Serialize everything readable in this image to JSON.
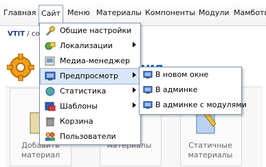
{
  "menubar": {
    "items": [
      "Главная",
      "Сайт",
      "Меню",
      "Материалы",
      "Компоненты",
      "Модули",
      "Мамботы"
    ],
    "active": "Сайт"
  },
  "breadcrumb": {
    "strong": "VTIT",
    "rest": " / co"
  },
  "page": {
    "heading_fragment": "ция",
    "tiles": [
      {
        "label_line1": "Добавить",
        "label_line2": "материал"
      },
      {
        "label_line1": "",
        "label_line2": "материалы"
      },
      {
        "label_line1": "Статичные",
        "label_line2": "материалы"
      }
    ]
  },
  "dropdown": {
    "items": [
      {
        "label": "Общие настройки",
        "icon": "wrench-settings-icon",
        "submenu": false
      },
      {
        "label": "Локализации",
        "icon": "localization-icon",
        "submenu": true
      },
      {
        "label": "Медиа-менеджер",
        "icon": "media-manager-icon",
        "submenu": false
      },
      {
        "label": "Предпросмотр",
        "icon": "preview-monitor-icon",
        "submenu": true,
        "highlighted": true
      },
      {
        "label": "Статистика",
        "icon": "globe-statistics-icon",
        "submenu": true
      },
      {
        "label": "Шаблоны",
        "icon": "templates-icon",
        "submenu": true
      },
      {
        "label": "Корзина",
        "icon": "trash-icon",
        "submenu": false
      },
      {
        "label": "Пользователи",
        "icon": "users-icon",
        "submenu": false
      }
    ]
  },
  "submenu": {
    "items": [
      {
        "label": "В новом окне",
        "icon": "preview-monitor-icon"
      },
      {
        "label": "В админке",
        "icon": "preview-monitor-icon"
      },
      {
        "label": "В админке с модулями",
        "icon": "preview-monitor-icon"
      }
    ]
  },
  "colors": {
    "highlight": "#d9e6f7",
    "heading": "#0b55a8",
    "breadcrumb_strong": "#1a3d7a",
    "menu_border": "#7f8fa5"
  }
}
